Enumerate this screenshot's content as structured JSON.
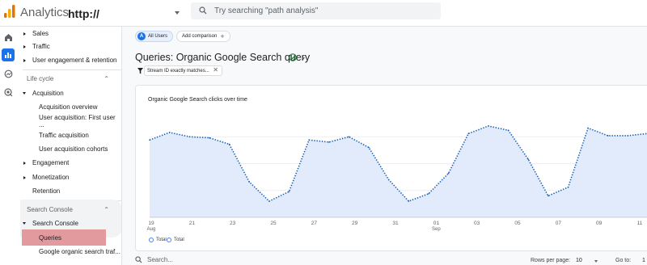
{
  "topbar": {
    "app_title": "Analytics",
    "property": "http://",
    "search_placeholder": "Try searching \"path analysis\""
  },
  "rail": {
    "icons": [
      "home-icon",
      "reports-icon",
      "explore-icon",
      "advertising-icon"
    ]
  },
  "sidebar": {
    "top_items": [
      "Sales",
      "Traffic",
      "User engagement & retention"
    ],
    "lifecycle_header": "Life cycle",
    "acquisition": "Acquisition",
    "acquisition_items": [
      "Acquisition overview",
      "User acquisition: First user ...",
      "Traffic acquisition",
      "User acquisition cohorts"
    ],
    "engagement": "Engagement",
    "monetization": "Monetization",
    "retention": "Retention",
    "search_console_header": "Search Console",
    "search_console": "Search Console",
    "search_console_items": [
      "Queries",
      "Google organic search traf..."
    ]
  },
  "main": {
    "chip_badge": "A",
    "chip_all_users": "All Users",
    "add_comparison": "Add comparison",
    "page_title": "Queries: Organic Google Search query",
    "filter_text": "Stream ID exactly matches...",
    "card_title": "Organic Google Search clicks over time",
    "legend": [
      "Total",
      "Total"
    ],
    "bottom_search_placeholder": "Search...",
    "rows_per_page_label": "Rows per page:",
    "rows_per_page_value": "10",
    "goto_label": "Go to:",
    "goto_value": "1"
  },
  "chart_data": {
    "type": "area",
    "x_ticks": [
      "19",
      "21",
      "23",
      "25",
      "27",
      "29",
      "31",
      "01",
      "03",
      "05",
      "07",
      "09",
      "11"
    ],
    "x_subticks": [
      "Aug",
      "",
      "",
      "",
      "",
      "",
      "",
      "Sep",
      "",
      "",
      "",
      "",
      ""
    ],
    "values": [
      72,
      79,
      75,
      74,
      68,
      33,
      15,
      24,
      72,
      70,
      75,
      65,
      35,
      15,
      22,
      41,
      78,
      85,
      81,
      54,
      20,
      28,
      83,
      76,
      76,
      78
    ],
    "ylim": [
      0,
      100
    ],
    "line_color": "#1a5fb4",
    "fill_color": "#e1ebfb"
  }
}
